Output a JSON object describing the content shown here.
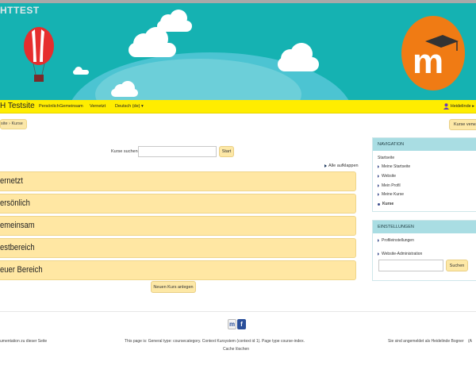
{
  "banner": {
    "brand_text": "HTTEST",
    "logo_letter": "m",
    "colors": {
      "sky": "#15b2b2",
      "logo": "#f07b14",
      "balloon": "#e62e2e"
    }
  },
  "navbar": {
    "site_name": "H Testsite",
    "items": [
      "Persönlich",
      "Gemeinsam",
      "Vernetzt",
      "Deutsch (de) ▾"
    ],
    "user": "Heidelinde ▸",
    "color": "#ffed00"
  },
  "breadcrumb": {
    "home": "site",
    "separator": "›",
    "current": "Kurse"
  },
  "manage_button": "Kurse verwa",
  "search": {
    "label": "Kurse suchen:",
    "value": "",
    "button": "Start"
  },
  "collapse_all": "Alle aufklappen",
  "categories": [
    "ernetzt",
    "ersönlich",
    "emeinsam",
    "estbereich",
    "euer Bereich"
  ],
  "new_course_button": "Neuen Kurs anlegen",
  "navigation_block": {
    "title": "NAVIGATION",
    "root": "Startseite",
    "items": [
      "Meine Startseite",
      "Website",
      "Mein Profil",
      "Meine Kurse"
    ],
    "active": "Kurse"
  },
  "settings_block": {
    "title": "EINSTELLUNGEN",
    "items": [
      "Profileinstellungen",
      "Website-Administration"
    ],
    "search_value": "",
    "search_button": "Suchen"
  },
  "footer": {
    "doc_link": "umentation zu dieser Seite",
    "page_info": "This page is: General type: coursecategory. Context Kursystem (context id 1). Page type course-index.",
    "purge_caches": "Cache löschen",
    "login_info": "Sie sind angemeldet als Heidelinde Bogner",
    "logout_fragment": "(A",
    "icons": [
      "moodle-icon",
      "facebook-icon"
    ]
  }
}
